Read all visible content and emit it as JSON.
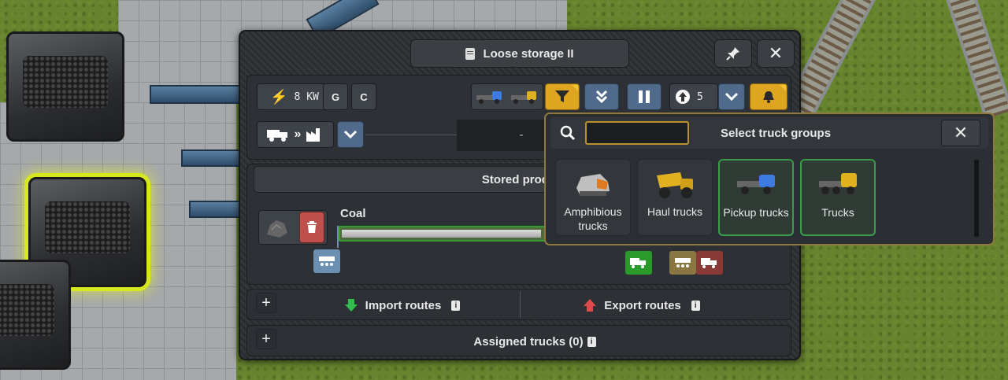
{
  "window": {
    "title": "Loose storage II",
    "pin_icon": "pin-icon",
    "close_icon": "close-icon"
  },
  "toolbar": {
    "power_value": "8 KW",
    "g_label": "G",
    "c_label": "C",
    "priority_value": "5",
    "route_dash": "-"
  },
  "stored_products": {
    "title": "Stored produ",
    "product_name": "Coal",
    "fill_level": 0.93
  },
  "routes": {
    "import_label": "Import routes",
    "export_label": "Export routes",
    "info_symbol": "i",
    "plus_symbol": "+"
  },
  "assigned_trucks": {
    "label": "Assigned trucks (0)"
  },
  "popup": {
    "title": "Select truck groups",
    "search_value": "",
    "groups": [
      {
        "label": "Amphibious trucks",
        "selected": false
      },
      {
        "label": "Haul trucks",
        "selected": false
      },
      {
        "label": "Pickup trucks",
        "selected": true
      },
      {
        "label": "Trucks",
        "selected": true
      }
    ]
  },
  "colors": {
    "accent_gold": "#e0a520",
    "import_green": "#2fbf4a",
    "export_red": "#e04a4a",
    "selected_green": "#3a9b4a"
  }
}
